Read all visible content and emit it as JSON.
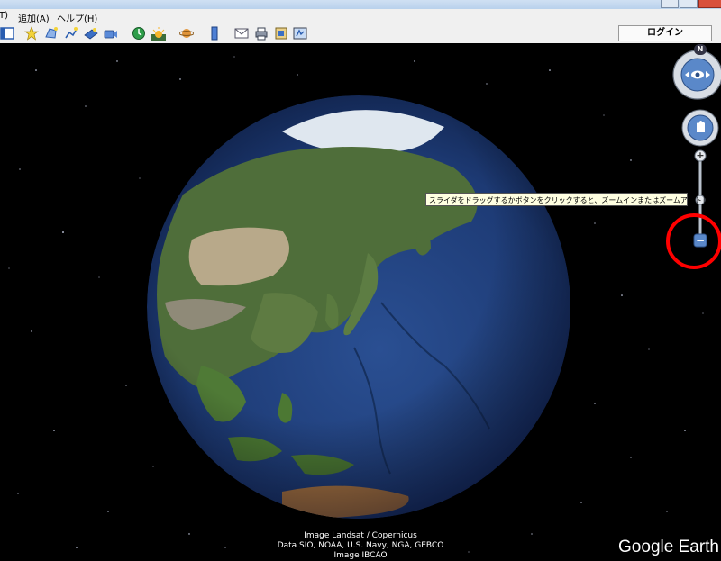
{
  "menu": {
    "items": [
      "T)",
      "追加(A)",
      "ヘルプ(H)"
    ]
  },
  "toolbar": {
    "login_label": "ログイン",
    "icons": [
      "sidebar-toggle-icon",
      "placemark-icon",
      "polygon-icon",
      "path-icon",
      "image-overlay-icon",
      "record-tour-icon",
      "historical-imagery-icon",
      "sunlight-icon",
      "planets-icon",
      "ruler-icon",
      "email-icon",
      "print-icon",
      "save-image-icon",
      "view-in-maps-icon"
    ]
  },
  "map": {
    "tooltip": "スライダをドラッグするかボタンをクリックすると、ズームインまたはズームアウトします",
    "compass_north": "N",
    "zoom_in_symbol": "+",
    "zoom_out_symbol": "−",
    "credits": [
      "Image Landsat / Copernicus",
      "Data SIO, NOAA, U.S. Navy, NGA, GEBCO",
      "Image IBCAO"
    ],
    "brand": "Google Earth"
  },
  "colors": {
    "space": "#000000",
    "ocean": "#1f3f7a",
    "highlight": "#ff0000"
  }
}
